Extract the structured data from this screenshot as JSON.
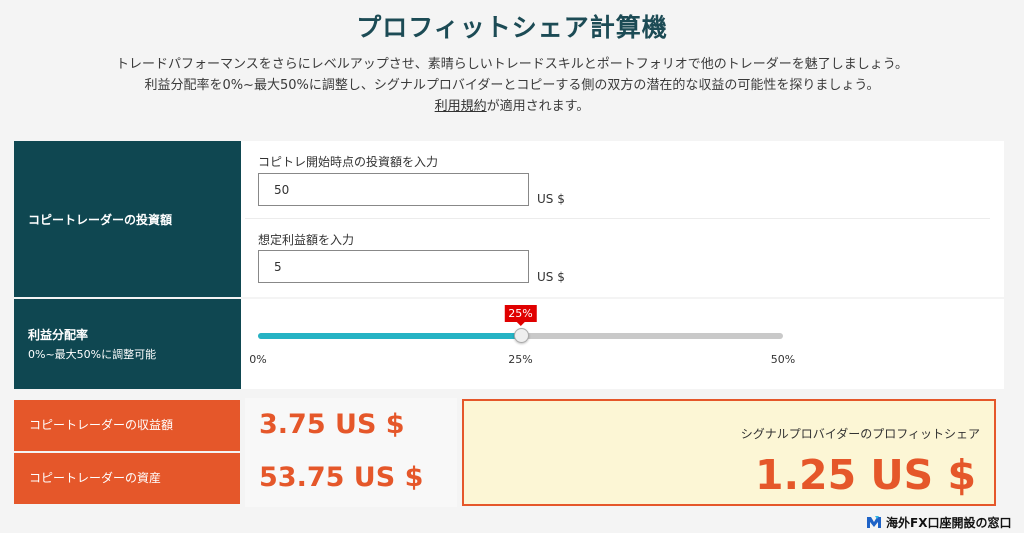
{
  "header": {
    "title": "プロフィットシェア計算機",
    "desc_line1": "トレードパフォーマンスをさらにレベルアップさせ、素晴らしいトレードスキルとポートフォリオで他のトレーダーを魅了しましょう。",
    "desc_line2": "利益分配率を0%~最大50%に調整し、シグナルプロバイダーとコピーする側の双方の潜在的な収益の可能性を探りましょう。",
    "terms_link": "利用規約",
    "terms_suffix": "が適用されます。"
  },
  "investment": {
    "section_label": "コピートレーダーの投資額",
    "initial_label": "コピトレ開始時点の投資額を入力",
    "initial_value": "50",
    "initial_unit": "US $",
    "profit_label": "想定利益額を入力",
    "profit_value": "5",
    "profit_unit": "US $"
  },
  "share_rate": {
    "section_label": "利益分配率",
    "section_sublabel": "0%~最大50%に調整可能",
    "value_percent": 25,
    "max_percent": 50,
    "bubble": "25%",
    "ticks": [
      "0%",
      "25%",
      "50%"
    ]
  },
  "results": {
    "earnings_label": "コピートレーダーの収益額",
    "earnings_value": "3.75 US $",
    "assets_label": "コピートレーダーの資産",
    "assets_value": "53.75 US $",
    "provider_label": "シグナルプロバイダーのプロフィットシェア",
    "provider_value": "1.25 US $"
  },
  "brand": {
    "text": "海外FX口座開設の窓口"
  },
  "colors": {
    "teal_dark": "#0f4751",
    "orange": "#e5572a",
    "slider_fill": "#26b3c4",
    "bubble_red": "#e00000"
  }
}
